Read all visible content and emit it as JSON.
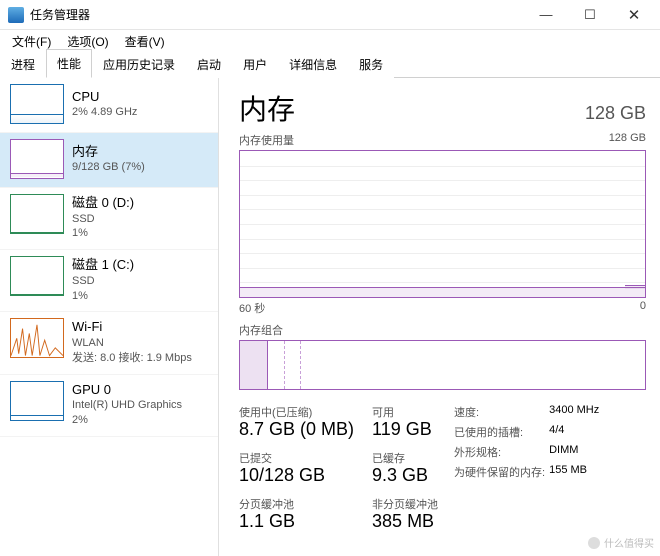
{
  "window": {
    "title": "任务管理器"
  },
  "menu": {
    "file": "文件(F)",
    "options": "选项(O)",
    "view": "查看(V)"
  },
  "tabs": {
    "t0": "进程",
    "t1": "性能",
    "t2": "应用历史记录",
    "t3": "启动",
    "t4": "用户",
    "t5": "详细信息",
    "t6": "服务"
  },
  "sidebar": {
    "cpu": {
      "name": "CPU",
      "line2": "2%  4.89 GHz"
    },
    "mem": {
      "name": "内存",
      "line2": "9/128 GB (7%)"
    },
    "disk0": {
      "name": "磁盘 0 (D:)",
      "line2": "SSD",
      "line3": "1%"
    },
    "disk1": {
      "name": "磁盘 1 (C:)",
      "line2": "SSD",
      "line3": "1%"
    },
    "wifi": {
      "name": "Wi-Fi",
      "line2": "WLAN",
      "line3": "发送: 8.0  接收: 1.9 Mbps"
    },
    "gpu": {
      "name": "GPU 0",
      "line2": "Intel(R) UHD Graphics",
      "line3": "2%"
    }
  },
  "detail": {
    "heading": "内存",
    "capacity": "128 GB",
    "chart_top_label": "内存使用量",
    "chart_top_right": "128 GB",
    "axis_left": "60 秒",
    "axis_right": "0",
    "comp_label": "内存组合",
    "stats": {
      "in_use_label": "使用中(已压缩)",
      "in_use_value": "8.7 GB (0 MB)",
      "avail_label": "可用",
      "avail_value": "119 GB",
      "commit_label": "已提交",
      "commit_value": "10/128 GB",
      "cached_label": "已缓存",
      "cached_value": "9.3 GB",
      "paged_label": "分页缓冲池",
      "paged_value": "1.1 GB",
      "nonpaged_label": "非分页缓冲池",
      "nonpaged_value": "385 MB"
    },
    "right": {
      "speed_l": "速度:",
      "speed_v": "3400 MHz",
      "slots_l": "已使用的插槽:",
      "slots_v": "4/4",
      "form_l": "外形规格:",
      "form_v": "DIMM",
      "hw_l": "为硬件保留的内存:",
      "hw_v": "155 MB"
    }
  },
  "watermark": "什么值得买",
  "chart_data": {
    "type": "area",
    "title": "内存使用量",
    "ylabel": "GB",
    "ylim": [
      0,
      128
    ],
    "x": [
      60,
      55,
      50,
      45,
      40,
      35,
      30,
      25,
      20,
      15,
      10,
      5,
      0
    ],
    "values": [
      9,
      9,
      9,
      9,
      9,
      9,
      9,
      9,
      9,
      9,
      9,
      9,
      9.5
    ],
    "composition": {
      "in_use_gb": 8.7,
      "modified_gb": 1.3,
      "standby_gb": 9.3,
      "free_gb": 108.7
    }
  }
}
